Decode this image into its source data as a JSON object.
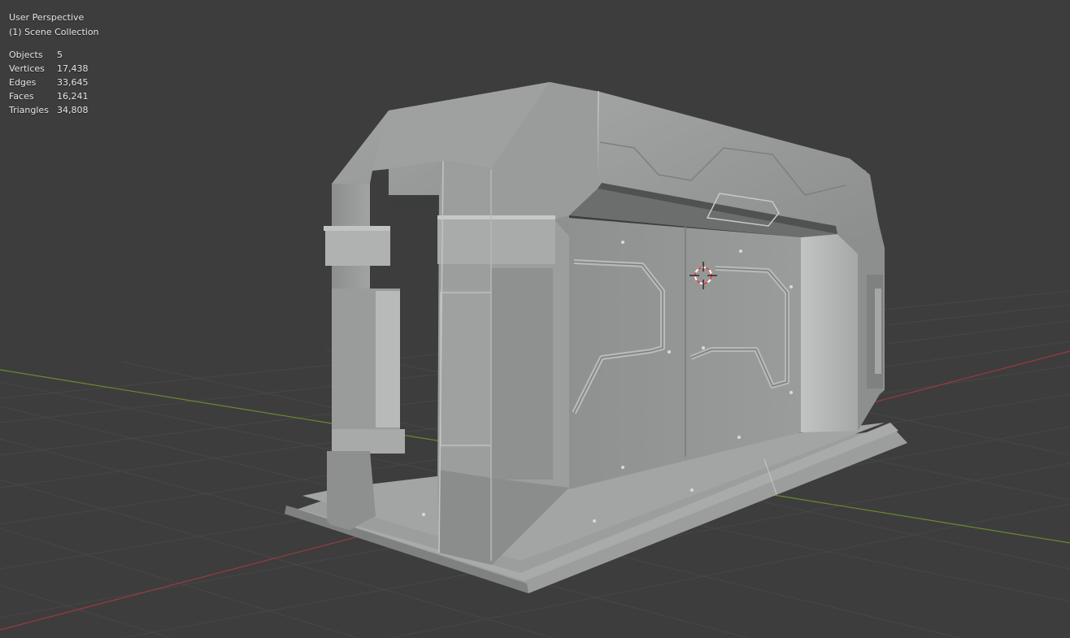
{
  "viewport": {
    "view_name": "User Perspective",
    "collection": "(1) Scene Collection"
  },
  "stats": [
    {
      "label": "Objects",
      "value": "5"
    },
    {
      "label": "Vertices",
      "value": "17,438"
    },
    {
      "label": "Edges",
      "value": "33,645"
    },
    {
      "label": "Faces",
      "value": "16,241"
    },
    {
      "label": "Triangles",
      "value": "34,808"
    }
  ],
  "colors": {
    "background": "#3d3d3d",
    "grid_line": "#454545",
    "x_axis": "#9a3a42",
    "y_axis": "#6a8a30",
    "model_light": "#a8aaa9",
    "model_mid": "#8f9190",
    "model_dark": "#6f7170",
    "cursor_red": "#e04040"
  }
}
